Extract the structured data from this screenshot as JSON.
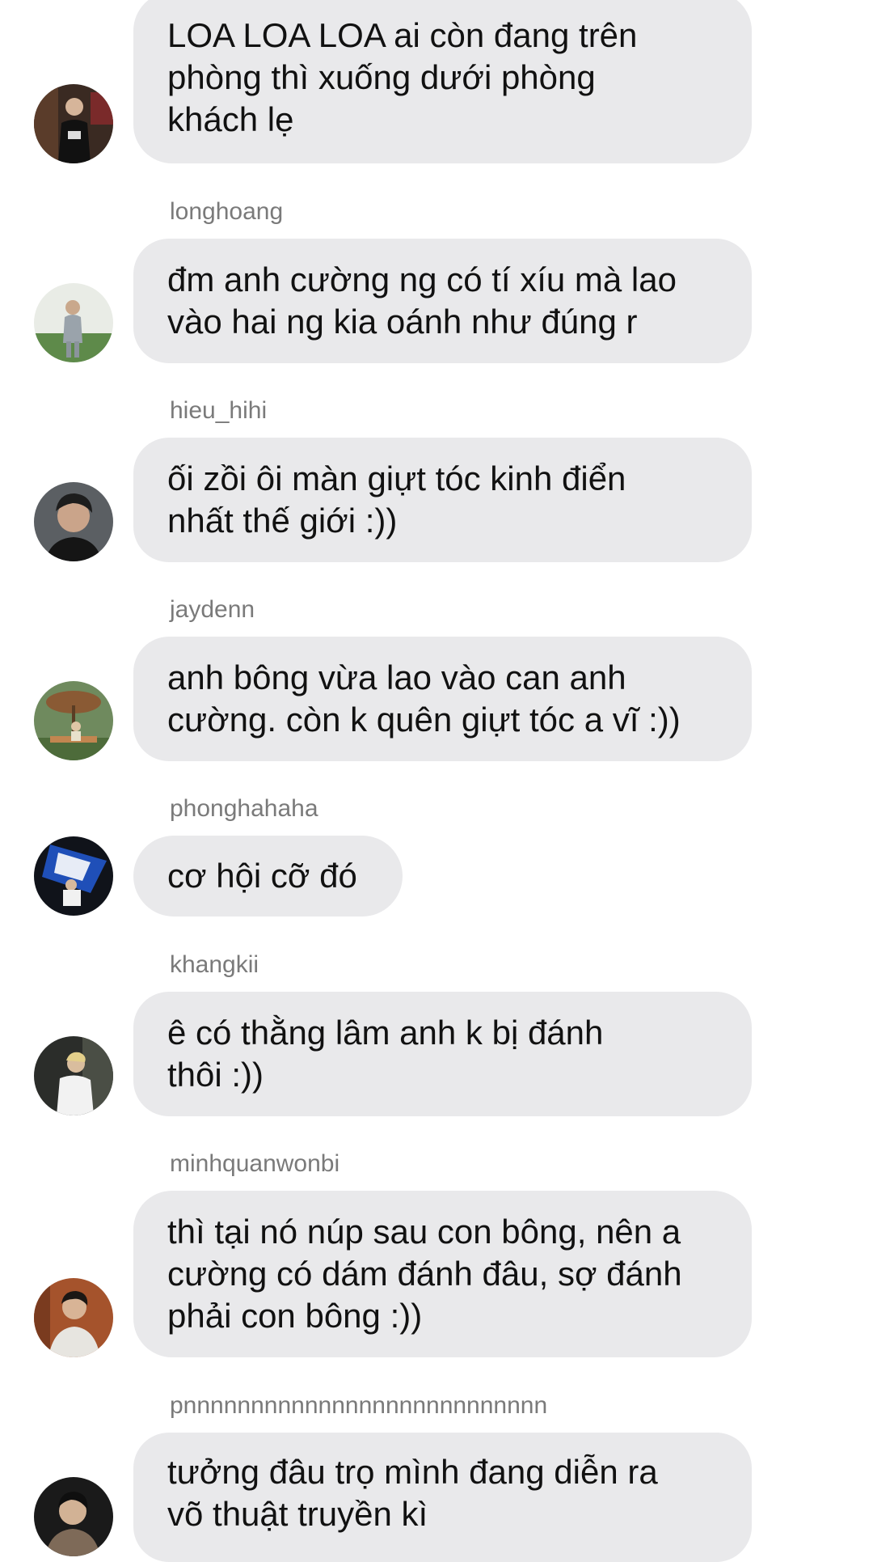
{
  "messages": [
    {
      "username": "",
      "text": "LOA LOA LOA ai còn đang trên\nphòng thì xuống dưới phòng\nkhách lẹ"
    },
    {
      "username": "longhoang",
      "text": "đm anh cường ng có tí xíu mà lao\nvào hai ng kia oánh như đúng r"
    },
    {
      "username": "hieu_hihi",
      "text": "ối zồi ôi màn giựt tóc kinh điển\nnhất thế giới :))"
    },
    {
      "username": "jaydenn",
      "text": "anh bông vừa lao vào can anh\ncường. còn k quên giựt tóc a vĩ :))"
    },
    {
      "username": "phonghahaha",
      "text": "cơ hội cỡ đó"
    },
    {
      "username": "khangkii",
      "text": "ê có thằng lâm anh k bị đánh\nthôi :))"
    },
    {
      "username": "minhquanwonbi",
      "text": "thì tại nó núp sau con bông, nên a\ncường có dám đánh đâu, sợ đánh\nphải con bông :))"
    },
    {
      "username": "pnnnnnnnnnnnnnnnnnnnnnnnnnnn",
      "text": "tưởng đâu trọ mình đang diễn ra\nvõ thuật truyền kì"
    }
  ],
  "colors": {
    "bubble": "#e9e9eb",
    "username": "#7a7a7a",
    "text": "#111111"
  }
}
